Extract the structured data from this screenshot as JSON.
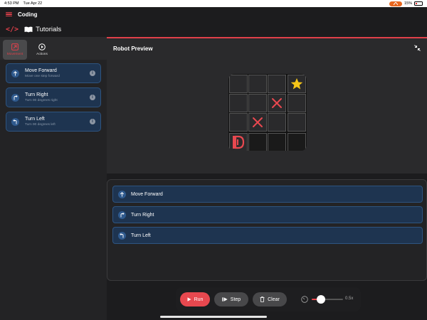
{
  "status": {
    "time": "4:53 PM",
    "date": "Tue Apr 22",
    "battery": "15%"
  },
  "app": {
    "title": "Coding"
  },
  "header": {
    "tutorials": "Tutorials"
  },
  "tabs": [
    {
      "label": "Movement",
      "active": true
    },
    {
      "label": "Actions",
      "active": false
    }
  ],
  "commands": [
    {
      "title": "Move Forward",
      "subtitle": "Move one step forward"
    },
    {
      "title": "Turn Right",
      "subtitle": "Turn 90 degrees right"
    },
    {
      "title": "Turn Left",
      "subtitle": "Turn 90 degrees left"
    }
  ],
  "preview": {
    "title": "Robot Preview",
    "grid_size": 4,
    "cells": [
      [
        "empty",
        "empty",
        "empty",
        "star"
      ],
      [
        "empty",
        "empty",
        "x",
        "empty"
      ],
      [
        "empty",
        "x",
        "empty",
        "empty"
      ],
      [
        "robot",
        "empty",
        "empty",
        "empty"
      ]
    ]
  },
  "program": [
    {
      "label": "Move Forward"
    },
    {
      "label": "Turn Right"
    },
    {
      "label": "Turn Left"
    }
  ],
  "controls": {
    "run": "Run",
    "step": "Step",
    "clear": "Clear",
    "speed": "0.5x",
    "speed_fraction": 0.3
  },
  "colors": {
    "accent": "#e8484f",
    "command_bg": "#1e3450",
    "star": "#f5c518"
  }
}
